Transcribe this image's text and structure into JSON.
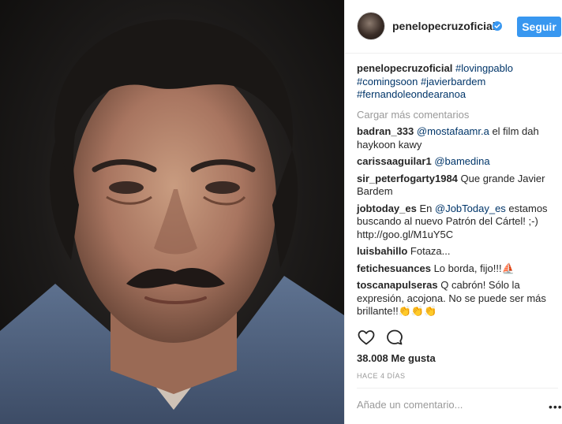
{
  "post": {
    "username": "penelopecruzoficial",
    "follow_label": "Seguir",
    "caption": {
      "user": "penelopecruzoficial",
      "tags": "#lovingpablo #comingsoon #javierbardem #fernandoleondearanoa"
    },
    "load_more": "Cargar más comentarios",
    "comments": [
      {
        "user": "badran_333",
        "mention": "@mostafaamr.a",
        "text": " el film dah haykoon kawy"
      },
      {
        "user": "carissaaguilar1",
        "mention": "@bamedina",
        "text": ""
      },
      {
        "user": "sir_peterfogarty1984",
        "mention": "",
        "text": "Que grande Javier Bardem"
      },
      {
        "user": "jobtoday_es",
        "mention": "@JobToday_es",
        "text_before": "En ",
        "text": " estamos buscando al nuevo Patrón del Cártel! ;-) http://goo.gl/M1uY5C"
      },
      {
        "user": "luisbahillo",
        "mention": "",
        "text": "Fotaza..."
      },
      {
        "user": "fetichesuances",
        "mention": "",
        "text": "Lo borda, fijo!!!⛵"
      },
      {
        "user": "toscanapulseras",
        "mention": "",
        "text": "Q cabrón! Sólo la expresión, acojona. No se puede ser más brillante!!👏👏👏"
      }
    ],
    "likes": "38.008 Me gusta",
    "time_ago": "HACE 4 DÍAS",
    "add_comment_placeholder": "Añade un comentario...",
    "more_options": "•••",
    "icons": {
      "like": "heart-icon",
      "comment": "speech-bubble-icon",
      "verified": "verified-badge-icon",
      "options": "more-options-icon"
    },
    "colors": {
      "accent": "#3897f0",
      "link": "#003569",
      "muted": "#999999",
      "text": "#262626"
    }
  }
}
